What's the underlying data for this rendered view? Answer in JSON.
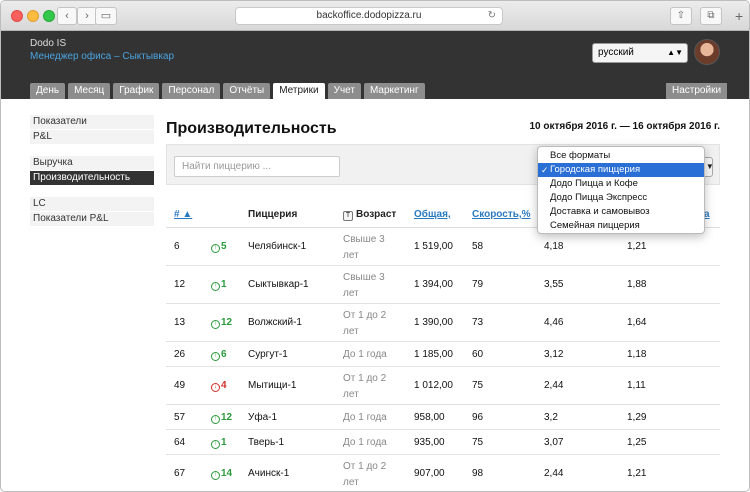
{
  "browser": {
    "url": "backoffice.dodopizza.ru"
  },
  "header": {
    "brand": "Dodo IS",
    "office": "Менеджер офиса – Сыктывкар",
    "language": "русский"
  },
  "tabs": [
    "День",
    "Месяц",
    "График",
    "Персонал",
    "Отчёты",
    "Метрики",
    "Учет",
    "Маркетинг"
  ],
  "active_tab": "Метрики",
  "settings_label": "Настройки",
  "sidebar": {
    "group1": [
      "Показатели",
      "P&L"
    ],
    "group2": [
      "Выручка",
      "Производительность"
    ],
    "group3": [
      "LC",
      "Показатели P&L"
    ]
  },
  "main": {
    "title": "Производительность",
    "date_range": "10 октября 2016 г. — 16 октября 2016 г.",
    "search_placeholder": "Найти пиццерию ..."
  },
  "dropdown": {
    "options": [
      "Все форматы",
      "Городская пиццерия",
      "Додо Пицца и Кофе",
      "Додо Пицца Экспресс",
      "Доставка и самовывоз",
      "Семейная пиццерия"
    ],
    "selected": "Городская пиццерия"
  },
  "table": {
    "headers": {
      "num": "# ▲",
      "pizzeria": "Пиццерия",
      "age_icon": "T",
      "age": "Возраст",
      "total": "Общая,",
      "speed": "Скорость,%",
      "last": "а"
    },
    "rows": [
      {
        "num": "6",
        "delta": "5",
        "dir": "up",
        "name": "Челябинск-1",
        "age": "Свыше 3 лет",
        "total": "1 519,00",
        "speed": "58",
        "c1": "4,18",
        "c2": "1,21"
      },
      {
        "num": "12",
        "delta": "1",
        "dir": "up",
        "name": "Сыктывкар-1",
        "age": "Свыше 3 лет",
        "total": "1 394,00",
        "speed": "79",
        "c1": "3,55",
        "c2": "1,88"
      },
      {
        "num": "13",
        "delta": "12",
        "dir": "up",
        "name": "Волжский-1",
        "age": "От 1 до 2 лет",
        "total": "1 390,00",
        "speed": "73",
        "c1": "4,46",
        "c2": "1,64"
      },
      {
        "num": "26",
        "delta": "6",
        "dir": "up",
        "name": "Сургут-1",
        "age": "До 1 года",
        "total": "1 185,00",
        "speed": "60",
        "c1": "3,12",
        "c2": "1,18"
      },
      {
        "num": "49",
        "delta": "4",
        "dir": "down",
        "name": "Мытищи-1",
        "age": "От 1 до 2 лет",
        "total": "1 012,00",
        "speed": "75",
        "c1": "2,44",
        "c2": "1,11"
      },
      {
        "num": "57",
        "delta": "12",
        "dir": "up",
        "name": "Уфа-1",
        "age": "До 1 года",
        "total": "958,00",
        "speed": "96",
        "c1": "3,2",
        "c2": "1,29"
      },
      {
        "num": "64",
        "delta": "1",
        "dir": "up",
        "name": "Тверь-1",
        "age": "До 1 года",
        "total": "935,00",
        "speed": "75",
        "c1": "3,07",
        "c2": "1,25"
      },
      {
        "num": "67",
        "delta": "14",
        "dir": "up",
        "name": "Ачинск-1",
        "age": "От 1 до 2 лет",
        "total": "907,00",
        "speed": "98",
        "c1": "2,44",
        "c2": "1,21"
      }
    ]
  }
}
